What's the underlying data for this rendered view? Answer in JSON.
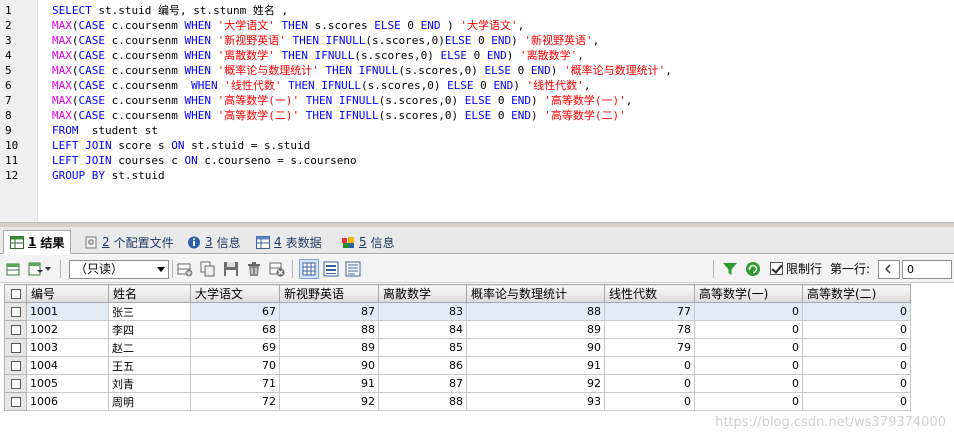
{
  "editor": {
    "line_numbers": [
      "1",
      "2",
      "3",
      "4",
      "5",
      "6",
      "7",
      "8",
      "9",
      "10",
      "11",
      "12"
    ],
    "lines": [
      [
        [
          "kw",
          "SELECT"
        ],
        [
          "id",
          " st.stuid 编号, st.stunm 姓名 ,"
        ]
      ],
      [
        [
          "fn",
          "MAX"
        ],
        [
          "id",
          "("
        ],
        [
          "kw",
          "CASE"
        ],
        [
          "id",
          " c.coursenm "
        ],
        [
          "kw",
          "WHEN"
        ],
        [
          "id",
          " "
        ],
        [
          "str",
          "'大学语文'"
        ],
        [
          "id",
          " "
        ],
        [
          "kw",
          "THEN"
        ],
        [
          "id",
          " s.scores "
        ],
        [
          "kw",
          "ELSE"
        ],
        [
          "id",
          " 0 "
        ],
        [
          "kw",
          "END"
        ],
        [
          "id",
          " ) "
        ],
        [
          "str",
          "'大学语文'"
        ],
        [
          "id",
          ","
        ]
      ],
      [
        [
          "fn",
          "MAX"
        ],
        [
          "id",
          "("
        ],
        [
          "kw",
          "CASE"
        ],
        [
          "id",
          " c.coursenm "
        ],
        [
          "kw",
          "WHEN"
        ],
        [
          "id",
          " "
        ],
        [
          "str",
          "'新视野英语'"
        ],
        [
          "id",
          " "
        ],
        [
          "kw",
          "THEN"
        ],
        [
          "id",
          " "
        ],
        [
          "kw",
          "IFNULL"
        ],
        [
          "id",
          "(s.scores,0)"
        ],
        [
          "kw",
          "ELSE"
        ],
        [
          "id",
          " 0 "
        ],
        [
          "kw",
          "END"
        ],
        [
          "id",
          ") "
        ],
        [
          "str",
          "'新视野英语'"
        ],
        [
          "id",
          ","
        ]
      ],
      [
        [
          "fn",
          "MAX"
        ],
        [
          "id",
          "("
        ],
        [
          "kw",
          "CASE"
        ],
        [
          "id",
          " c.coursenm "
        ],
        [
          "kw",
          "WHEN"
        ],
        [
          "id",
          " "
        ],
        [
          "str",
          "'离散数学'"
        ],
        [
          "id",
          " "
        ],
        [
          "kw",
          "THEN"
        ],
        [
          "id",
          " "
        ],
        [
          "kw",
          "IFNULL"
        ],
        [
          "id",
          "(s.scores,0) "
        ],
        [
          "kw",
          "ELSE"
        ],
        [
          "id",
          " 0 "
        ],
        [
          "kw",
          "END"
        ],
        [
          "id",
          ") "
        ],
        [
          "str",
          "'离散数学'"
        ],
        [
          "id",
          ","
        ]
      ],
      [
        [
          "fn",
          "MAX"
        ],
        [
          "id",
          "("
        ],
        [
          "kw",
          "CASE"
        ],
        [
          "id",
          " c.coursenm "
        ],
        [
          "kw",
          "WHEN"
        ],
        [
          "id",
          " "
        ],
        [
          "str",
          "'概率论与数理统计'"
        ],
        [
          "id",
          " "
        ],
        [
          "kw",
          "THEN"
        ],
        [
          "id",
          " "
        ],
        [
          "kw",
          "IFNULL"
        ],
        [
          "id",
          "(s.scores,0) "
        ],
        [
          "kw",
          "ELSE"
        ],
        [
          "id",
          " 0 "
        ],
        [
          "kw",
          "END"
        ],
        [
          "id",
          ") "
        ],
        [
          "str",
          "'概率论与数理统计'"
        ],
        [
          "id",
          ","
        ]
      ],
      [
        [
          "fn",
          "MAX"
        ],
        [
          "id",
          "("
        ],
        [
          "kw",
          "CASE"
        ],
        [
          "id",
          " c.coursenm  "
        ],
        [
          "kw",
          "WHEN"
        ],
        [
          "id",
          " "
        ],
        [
          "str",
          "'线性代数'"
        ],
        [
          "id",
          " "
        ],
        [
          "kw",
          "THEN"
        ],
        [
          "id",
          " "
        ],
        [
          "kw",
          "IFNULL"
        ],
        [
          "id",
          "(s.scores,0) "
        ],
        [
          "kw",
          "ELSE"
        ],
        [
          "id",
          " 0 "
        ],
        [
          "kw",
          "END"
        ],
        [
          "id",
          ") "
        ],
        [
          "str",
          "'线性代数'"
        ],
        [
          "id",
          ","
        ]
      ],
      [
        [
          "fn",
          "MAX"
        ],
        [
          "id",
          "("
        ],
        [
          "kw",
          "CASE"
        ],
        [
          "id",
          " c.coursenm "
        ],
        [
          "kw",
          "WHEN"
        ],
        [
          "id",
          " "
        ],
        [
          "str",
          "'高等数学(一)'"
        ],
        [
          "id",
          " "
        ],
        [
          "kw",
          "THEN"
        ],
        [
          "id",
          " "
        ],
        [
          "kw",
          "IFNULL"
        ],
        [
          "id",
          "(s.scores,0) "
        ],
        [
          "kw",
          "ELSE"
        ],
        [
          "id",
          " 0 "
        ],
        [
          "kw",
          "END"
        ],
        [
          "id",
          ") "
        ],
        [
          "str",
          "'高等数学(一)'"
        ],
        [
          "id",
          ","
        ]
      ],
      [
        [
          "fn",
          "MAX"
        ],
        [
          "id",
          "("
        ],
        [
          "kw",
          "CASE"
        ],
        [
          "id",
          " c.coursenm "
        ],
        [
          "kw",
          "WHEN"
        ],
        [
          "id",
          " "
        ],
        [
          "str",
          "'高等数学(二)'"
        ],
        [
          "id",
          " "
        ],
        [
          "kw",
          "THEN"
        ],
        [
          "id",
          " "
        ],
        [
          "kw",
          "IFNULL"
        ],
        [
          "id",
          "(s.scores,0) "
        ],
        [
          "kw",
          "ELSE"
        ],
        [
          "id",
          " 0 "
        ],
        [
          "kw",
          "END"
        ],
        [
          "id",
          ") "
        ],
        [
          "str",
          "'高等数学(二)'"
        ]
      ],
      [
        [
          "kw",
          "FROM"
        ],
        [
          "id",
          "  student st"
        ]
      ],
      [
        [
          "kw",
          "LEFT JOIN"
        ],
        [
          "id",
          " score s "
        ],
        [
          "kw",
          "ON"
        ],
        [
          "id",
          " st.stuid = s.stuid"
        ]
      ],
      [
        [
          "kw",
          "LEFT JOIN"
        ],
        [
          "id",
          " courses c "
        ],
        [
          "kw",
          "ON"
        ],
        [
          "id",
          " c.courseno = s.courseno"
        ]
      ],
      [
        [
          "kw",
          "GROUP BY"
        ],
        [
          "id",
          " st.stuid"
        ]
      ]
    ]
  },
  "tabs": [
    {
      "num": "1",
      "label": "结果",
      "icon": "grid-icon",
      "active": true
    },
    {
      "num": "2",
      "label": "个配置文件",
      "icon": "profile-icon",
      "active": false
    },
    {
      "num": "3",
      "label": "信息",
      "icon": "info-icon",
      "active": false
    },
    {
      "num": "4",
      "label": "表数据",
      "icon": "table-icon",
      "active": false
    },
    {
      "num": "5",
      "label": "信息",
      "icon": "info-color-icon",
      "active": false
    }
  ],
  "toolbar": {
    "mode_select": "（只读）",
    "limit_label": "限制行",
    "first_row_label": "第一行:",
    "first_row_value": "0",
    "limit_checked": true
  },
  "grid": {
    "columns": [
      "编号",
      "姓名",
      "大学语文",
      "新视野英语",
      "离散数学",
      "概率论与数理统计",
      "线性代数",
      "高等数学(一)",
      "高等数学(二)"
    ],
    "rows": [
      [
        "1001",
        "张三",
        "67",
        "87",
        "83",
        "88",
        "77",
        "0",
        "0"
      ],
      [
        "1002",
        "李四",
        "68",
        "88",
        "84",
        "89",
        "78",
        "0",
        "0"
      ],
      [
        "1003",
        "赵二",
        "69",
        "89",
        "85",
        "90",
        "79",
        "0",
        "0"
      ],
      [
        "1004",
        "王五",
        "70",
        "90",
        "86",
        "91",
        "0",
        "0",
        "0"
      ],
      [
        "1005",
        "刘青",
        "71",
        "91",
        "87",
        "92",
        "0",
        "0",
        "0"
      ],
      [
        "1006",
        "周明",
        "72",
        "92",
        "88",
        "93",
        "0",
        "0",
        "0"
      ]
    ]
  },
  "watermark": "https://blog.csdn.net/ws379374000",
  "colors": {
    "keyword": "#0000ff",
    "function": "#e000e0",
    "string": "#ff0000",
    "selected_row": "#e2ecf7"
  }
}
